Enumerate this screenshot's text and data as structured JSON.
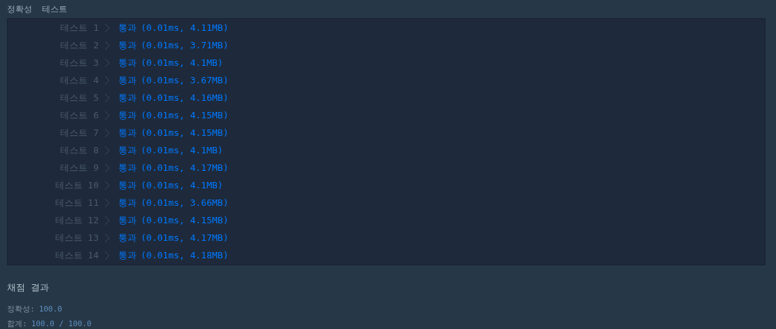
{
  "section_title": "정확성  테스트",
  "tests": [
    {
      "label": "테스트 1",
      "passed": true,
      "status": "통과",
      "detail": "(0.01ms, 4.11MB)"
    },
    {
      "label": "테스트 2",
      "passed": true,
      "status": "통과",
      "detail": "(0.01ms, 3.71MB)"
    },
    {
      "label": "테스트 3",
      "passed": true,
      "status": "통과",
      "detail": "(0.01ms, 4.1MB)"
    },
    {
      "label": "테스트 4",
      "passed": true,
      "status": "통과",
      "detail": "(0.01ms, 3.67MB)"
    },
    {
      "label": "테스트 5",
      "passed": true,
      "status": "통과",
      "detail": "(0.01ms, 4.16MB)"
    },
    {
      "label": "테스트 6",
      "passed": true,
      "status": "통과",
      "detail": "(0.01ms, 4.15MB)"
    },
    {
      "label": "테스트 7",
      "passed": true,
      "status": "통과",
      "detail": "(0.01ms, 4.15MB)"
    },
    {
      "label": "테스트 8",
      "passed": true,
      "status": "통과",
      "detail": "(0.01ms, 4.1MB)"
    },
    {
      "label": "테스트 9",
      "passed": true,
      "status": "통과",
      "detail": "(0.01ms, 4.17MB)"
    },
    {
      "label": "테스트 10",
      "passed": true,
      "status": "통과",
      "detail": "(0.01ms, 4.1MB)"
    },
    {
      "label": "테스트 11",
      "passed": true,
      "status": "통과",
      "detail": "(0.01ms, 3.66MB)"
    },
    {
      "label": "테스트 12",
      "passed": true,
      "status": "통과",
      "detail": "(0.01ms, 4.15MB)"
    },
    {
      "label": "테스트 13",
      "passed": true,
      "status": "통과",
      "detail": "(0.01ms, 4.17MB)"
    },
    {
      "label": "테스트 14",
      "passed": true,
      "status": "통과",
      "detail": "(0.01ms, 4.18MB)"
    }
  ],
  "summary": {
    "title": "채점 결과",
    "lines": [
      {
        "label": "정확성:",
        "value": "100.0"
      },
      {
        "label": "합계:",
        "value": "100.0 / 100.0"
      }
    ]
  }
}
